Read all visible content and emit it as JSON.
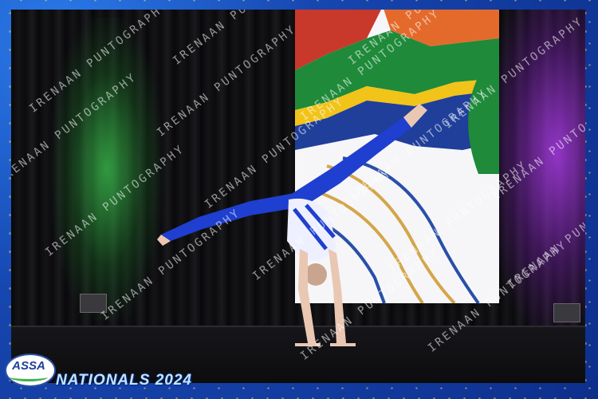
{
  "event": {
    "title": "NATIONALS 2024",
    "logo_text": "ASSA"
  },
  "watermark": {
    "text": "IRENAAN PUNTOGRAPHY"
  },
  "colors": {
    "border_blue": "#1646b0",
    "gold_speckle": "#e8c65a",
    "leotard_blue": "#1f3fd0",
    "stage_light_green": "#3cc850",
    "stage_light_purple": "#aa3ce6"
  },
  "icons": {
    "logo": "assa-logo-badge"
  }
}
